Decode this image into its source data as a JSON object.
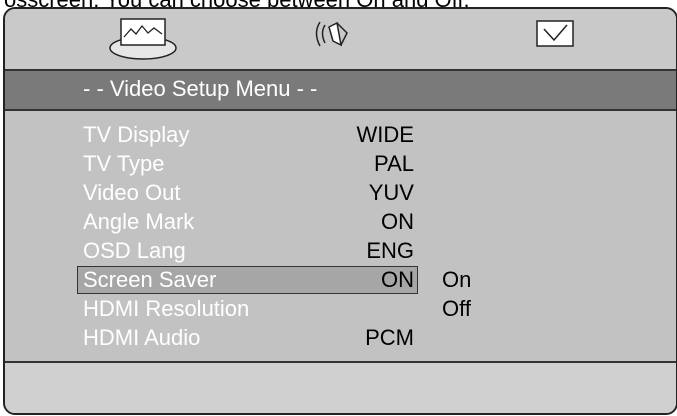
{
  "caption": "osscreen. You can choose between On and Off.",
  "toolbar": {
    "icons": [
      "video-setup-icon",
      "audio-setup-icon",
      "preference-checkbox-icon"
    ]
  },
  "menu": {
    "title": "- - Video Setup Menu - -",
    "items": [
      {
        "label": "TV Display",
        "value": "WIDE"
      },
      {
        "label": "TV Type",
        "value": "PAL"
      },
      {
        "label": "Video Out",
        "value": "YUV"
      },
      {
        "label": "Angle Mark",
        "value": "ON"
      },
      {
        "label": "OSD Lang",
        "value": "ENG"
      },
      {
        "label": "Screen Saver",
        "value": "ON",
        "selected": true
      },
      {
        "label": "HDMI Resolution",
        "value": ""
      },
      {
        "label": "HDMI Audio",
        "value": "PCM"
      }
    ],
    "options": [
      "On",
      "Off"
    ]
  }
}
